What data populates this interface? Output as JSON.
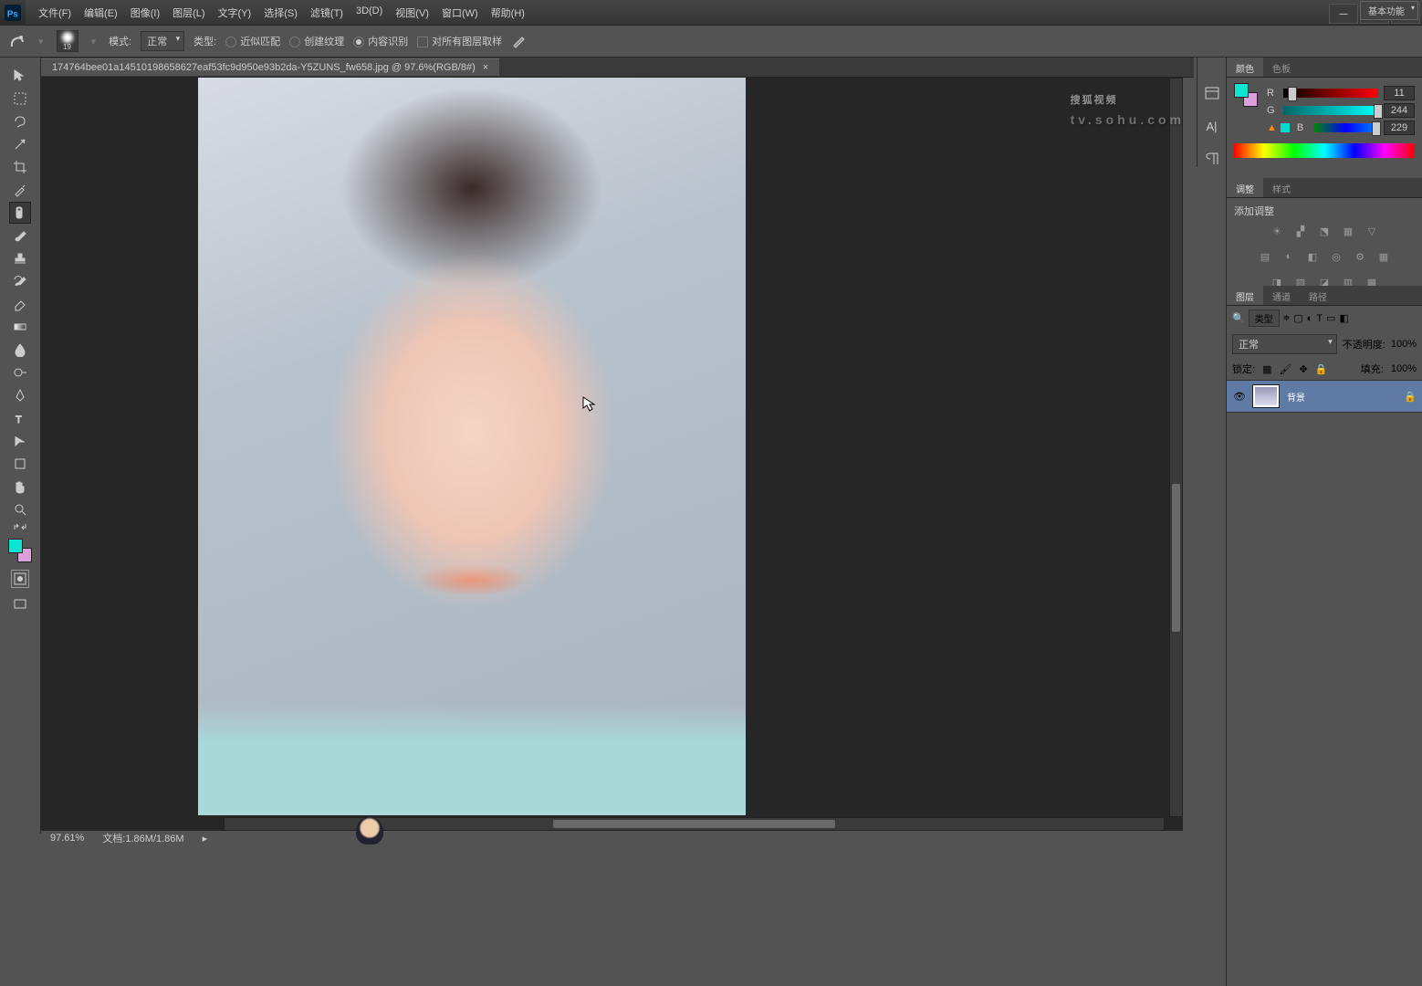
{
  "menu": {
    "file": "文件(F)",
    "edit": "编辑(E)",
    "image": "图像(I)",
    "layer": "图层(L)",
    "text": "文字(Y)",
    "select": "选择(S)",
    "filter": "滤镜(T)",
    "d3": "3D(D)",
    "view": "视图(V)",
    "window": "窗口(W)",
    "help": "帮助(H)"
  },
  "optbar": {
    "brush_size": "19",
    "mode_lbl": "模式:",
    "mode_val": "正常",
    "type_lbl": "类型:",
    "r1": "近似匹配",
    "r2": "创建纹理",
    "r3": "内容识别",
    "sample_all": "对所有图层取样"
  },
  "doc": {
    "tab": "174764bee01a14510198658627eaf53fc9d950e93b2da-Y5ZUNS_fw658.jpg @ 97.6%(RGB/8#)",
    "close": "×"
  },
  "status": {
    "zoom": "97.61%",
    "doc": "文档:1.86M/1.86M"
  },
  "color": {
    "tab1": "颜色",
    "tab2": "色板",
    "r_lbl": "R",
    "g_lbl": "G",
    "b_lbl": "B",
    "r": "11",
    "g": "244",
    "b": "229"
  },
  "adj": {
    "tab1": "调整",
    "tab2": "样式",
    "title": "添加调整"
  },
  "layers": {
    "tab1": "图层",
    "tab2": "通道",
    "tab3": "路径",
    "kind": "类型",
    "blend": "正常",
    "opacity_lbl": "不透明度:",
    "opacity": "100%",
    "lock_lbl": "锁定:",
    "fill_lbl": "填充:",
    "fill": "100%",
    "layer1": "背景"
  },
  "workspace": "基本功能",
  "watermark": {
    "cn": "搜狐视频",
    "en": "tv.sohu.com"
  }
}
